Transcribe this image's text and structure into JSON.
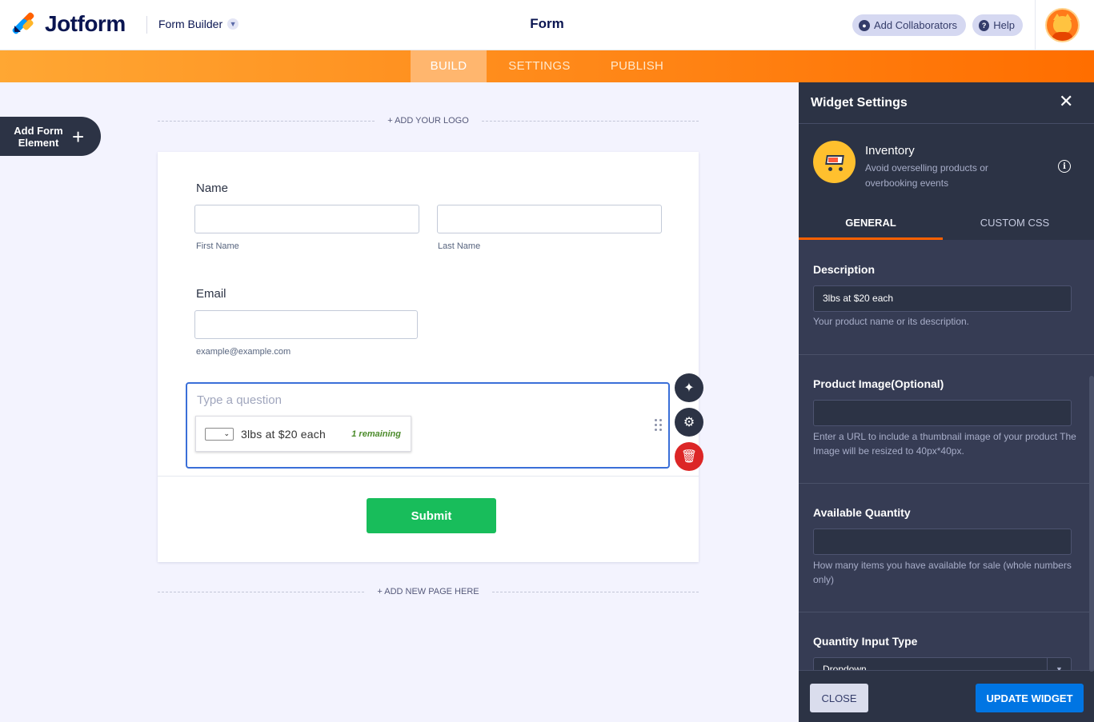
{
  "topbar": {
    "brand": "Jotform",
    "builder_dropdown": "Form Builder",
    "form_title": "Form",
    "add_collaborators": "Add Collaborators",
    "help": "Help"
  },
  "nav": {
    "tabs": [
      {
        "label": "BUILD",
        "active": true
      },
      {
        "label": "SETTINGS",
        "active": false
      },
      {
        "label": "PUBLISH",
        "active": false
      }
    ]
  },
  "left": {
    "add_element": "Add Form Element"
  },
  "form": {
    "add_logo": "+ ADD YOUR LOGO",
    "name_label": "Name",
    "first_name_sublabel": "First Name",
    "last_name_sublabel": "Last Name",
    "email_label": "Email",
    "email_sublabel": "example@example.com",
    "question_placeholder": "Type a question",
    "inventory_description": "3lbs at $20 each",
    "inventory_remaining": "1 remaining",
    "submit": "Submit",
    "add_new_page": "+ ADD NEW PAGE HERE"
  },
  "panel": {
    "title": "Widget Settings",
    "widget_name": "Inventory",
    "widget_description": "Avoid overselling products or overbooking events",
    "tabs": [
      {
        "label": "GENERAL",
        "active": true
      },
      {
        "label": "CUSTOM CSS",
        "active": false
      }
    ],
    "settings": {
      "description": {
        "label": "Description",
        "value": "3lbs at $20 each",
        "help": "Your product name or its description."
      },
      "product_image": {
        "label": "Product Image(Optional)",
        "value": "",
        "help": "Enter a URL to include a thumbnail image of your product The Image will be resized to 40px*40px."
      },
      "available_quantity": {
        "label": "Available Quantity",
        "value": "",
        "help": "How many items you have available for sale (whole numbers only)"
      },
      "quantity_input_type": {
        "label": "Quantity Input Type",
        "value": "Dropdown"
      }
    },
    "close": "CLOSE",
    "update": "UPDATE WIDGET"
  },
  "colors": {
    "accent_orange": "#ff6100",
    "submit_green": "#18bd5b",
    "update_blue": "#0075e3",
    "delete_red": "#dc2626",
    "panel_bg": "#363c54"
  }
}
